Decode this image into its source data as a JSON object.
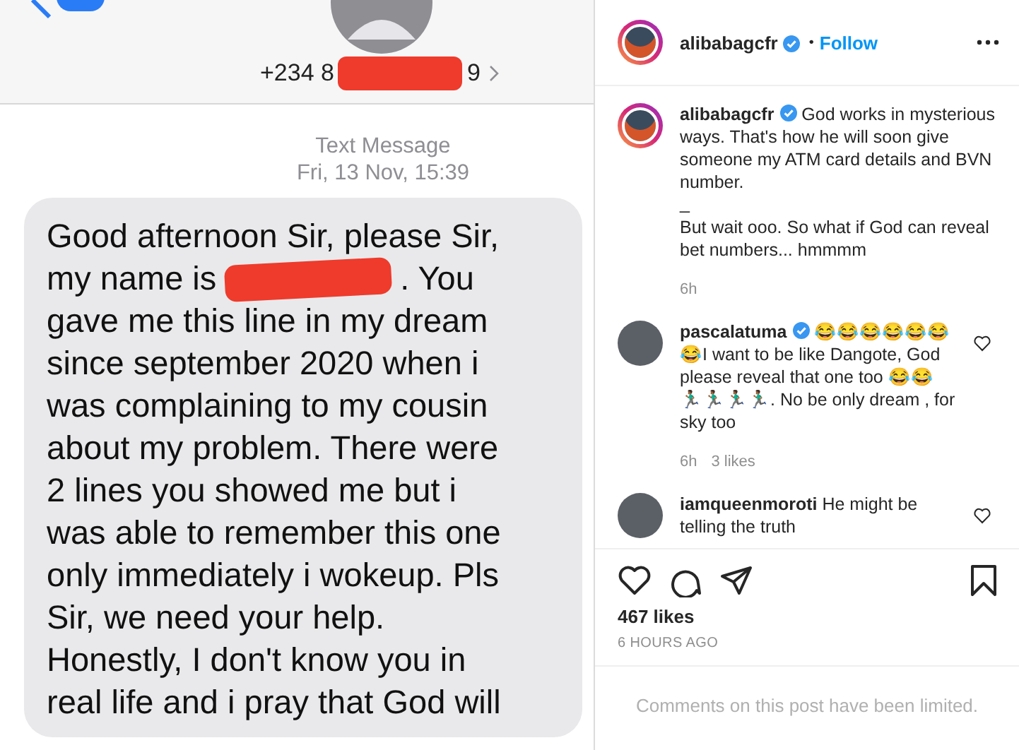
{
  "message_screen": {
    "contact_number_start": "+234 8",
    "contact_number_end": "9",
    "message_label": "Text Message",
    "timestamp": "Fri, 13 Nov, 15:39",
    "message_lines": [
      {
        "segments": [
          {
            "kind": "text",
            "text": "Good afternoon Sir, please Sir,"
          }
        ]
      },
      {
        "segments": [
          {
            "kind": "text",
            "text": "my name is"
          },
          {
            "kind": "redaction"
          },
          {
            "kind": "text",
            "text": ". You"
          }
        ]
      },
      {
        "segments": [
          {
            "kind": "text",
            "text": "gave me this line in my dream"
          }
        ]
      },
      {
        "segments": [
          {
            "kind": "text",
            "text": "since september 2020 when i"
          }
        ]
      },
      {
        "segments": [
          {
            "kind": "text",
            "text": "was complaining to my cousin"
          }
        ]
      },
      {
        "segments": [
          {
            "kind": "text",
            "text": "about my problem. There were"
          }
        ]
      },
      {
        "segments": [
          {
            "kind": "text",
            "text": "2 lines you showed me but i"
          }
        ]
      },
      {
        "segments": [
          {
            "kind": "text",
            "text": "was able to remember this one"
          }
        ]
      },
      {
        "segments": [
          {
            "kind": "text",
            "text": "only immediately i wokeup. Pls"
          }
        ]
      },
      {
        "segments": [
          {
            "kind": "text",
            "text": "Sir, we need your help."
          }
        ]
      },
      {
        "segments": [
          {
            "kind": "text",
            "text": "Honestly, I don't know you in"
          }
        ]
      },
      {
        "segments": [
          {
            "kind": "text",
            "text": "real life and i pray that God will"
          }
        ]
      }
    ]
  },
  "post": {
    "author": {
      "username": "alibabagcfr",
      "verified": true
    },
    "follow_separator": "•",
    "follow_label": "Follow",
    "caption": {
      "username": "alibabagcfr",
      "verified": true,
      "text": "God works in mysterious ways. That's how he will soon give someone my ATM card details and BVN number.",
      "separator": "_",
      "text_2": "But wait ooo. So what if God can reveal bet numbers... hmmmm",
      "time": "6h"
    },
    "comments": [
      {
        "username": "pascalatuma",
        "verified": true,
        "text": "😂😂😂😂😂😂😂I want to be like Dangote, God please reveal that one too 😂😂 🏃🏾‍♂️🏃🏾‍♂️🏃🏾‍♂️🏃🏾‍♂️. No be only dream , for sky too",
        "time": "6h",
        "likes": "3 likes"
      },
      {
        "username": "iamqueenmoroti",
        "verified": false,
        "text": "He might be telling the truth"
      }
    ],
    "likes": "467 likes",
    "posted": "6 HOURS AGO",
    "comments_notice": "Comments on this post have been limited."
  }
}
